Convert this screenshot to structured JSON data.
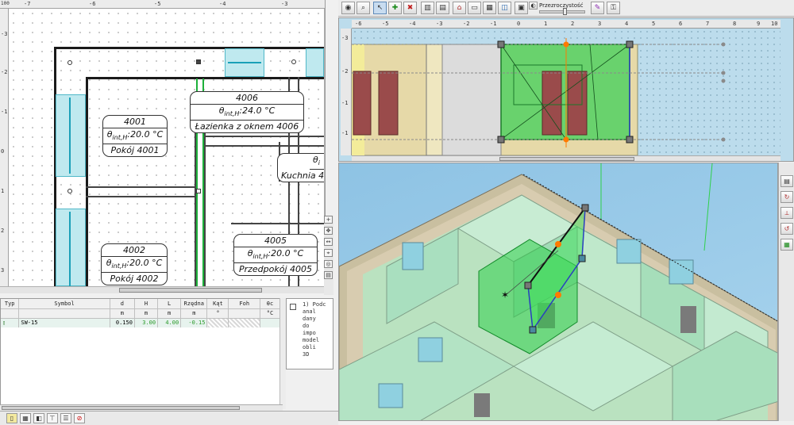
{
  "plan": {
    "ruler_top": [
      "-7",
      "-6",
      "-5",
      "-4",
      "-3"
    ],
    "ruler_left": [
      "-3",
      "-2",
      "-1",
      "0",
      "1",
      "2",
      "3"
    ],
    "ruler_corner": "100",
    "rooms": [
      {
        "id": "4006",
        "theta_label": "θ",
        "theta_sub": "int,H",
        "temp": ":24.0 °C",
        "name": "Łazienka z oknem 4006"
      },
      {
        "id": "4001",
        "theta_label": "θ",
        "theta_sub": "int,H",
        "temp": ":20.0 °C",
        "name": "Pokój 4001"
      },
      {
        "id": "4002",
        "theta_label": "θ",
        "theta_sub": "int,H",
        "temp": ":20.0 °C",
        "name": "Pokój 4002"
      },
      {
        "id": "4005",
        "theta_label": "θ",
        "theta_sub": "int,H",
        "temp": ":20.0 °C",
        "name": "Przedpokój 4005"
      },
      {
        "id": "",
        "theta_label": "θ",
        "theta_sub": "i",
        "temp": "",
        "name": "Kuchnia 4"
      }
    ]
  },
  "table": {
    "headers": [
      "Typ",
      "Symbol",
      "d",
      "H",
      "L",
      "Rzędna",
      "Kąt",
      "Foh",
      "θc"
    ],
    "units": [
      "",
      "",
      "m",
      "m",
      "m",
      "m",
      "°",
      "",
      "°C"
    ],
    "rows": [
      {
        "typ": "▯",
        "symbol": "SW-15",
        "d": "0.150",
        "h": "3.00",
        "l": "4.00",
        "rzedna": "-0.15",
        "kat": "",
        "foh": "",
        "tc": ""
      }
    ]
  },
  "note": {
    "lines": [
      "1) Podc",
      "anal",
      "dany",
      "do",
      "impo",
      "model",
      "obli",
      "3D"
    ]
  },
  "toolbar": {
    "opacity_label": "Przezroczystość",
    "icons": [
      "camera-icon",
      "zoom-icon",
      "select-icon",
      "add-element-icon",
      "delete-element-icon",
      "view-front-icon",
      "view-side-icon",
      "roof-icon",
      "floor-icon",
      "wall-icon",
      "window-icon",
      "slab-icon",
      "settings-icon",
      "opacity-icon",
      "brush-icon",
      "lock-icon"
    ]
  },
  "elevation": {
    "ruler_top": [
      "-6",
      "-5",
      "-4",
      "-3",
      "-2",
      "-1",
      "0",
      "1",
      "2",
      "3",
      "4",
      "5",
      "6",
      "7",
      "8",
      "9",
      "10"
    ],
    "ruler_left": [
      "-3",
      "-2",
      "-1",
      "-1"
    ]
  },
  "colors": {
    "selected_wall": "#3fcf5a",
    "glass": "#bfe9ef",
    "door": "#9a4b4b",
    "ground": "#e6d9a8",
    "sky3d": "#a9d4ee"
  }
}
